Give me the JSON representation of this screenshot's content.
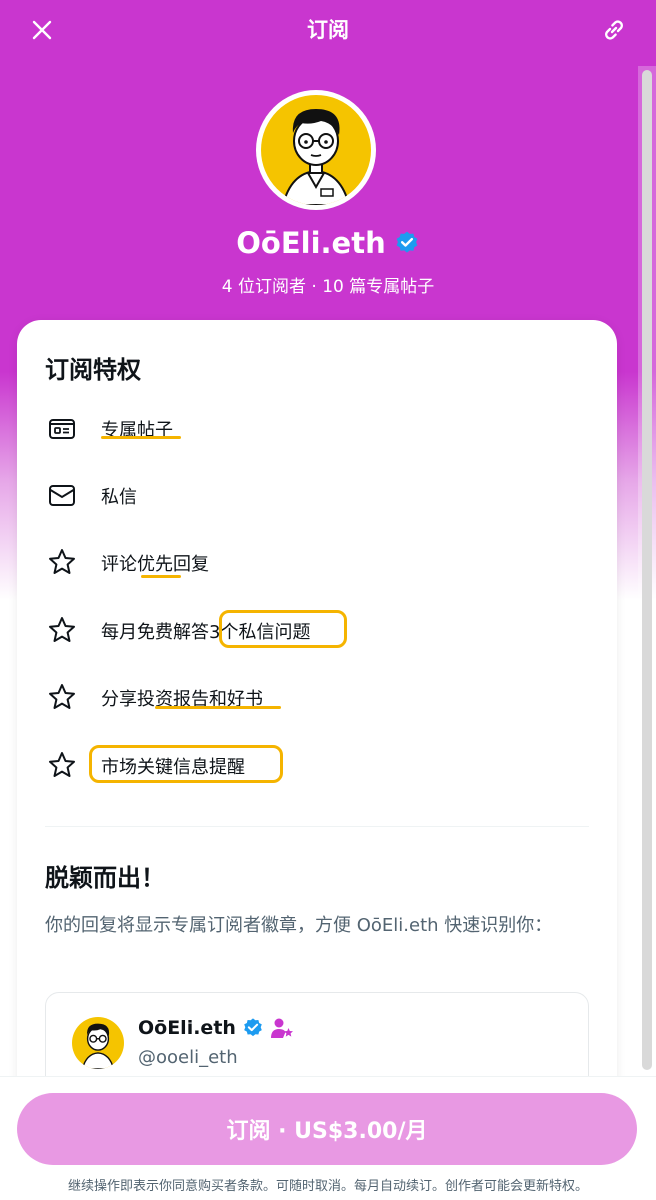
{
  "header": {
    "title": "订阅",
    "close_icon": "close-icon",
    "link_icon": "link-icon"
  },
  "profile": {
    "name": "OōEli.eth",
    "verified_icon": "verified-badge-icon",
    "stats": "4 位订阅者 · 10 篇专属帖子"
  },
  "perks": {
    "title": "订阅特权",
    "items": [
      {
        "icon": "post-card-icon",
        "label": "专属帖子"
      },
      {
        "icon": "mail-icon",
        "label": "私信"
      },
      {
        "icon": "star-icon",
        "label": "评论优先回复"
      },
      {
        "icon": "star-icon",
        "label": "每月免费解答3个私信问题"
      },
      {
        "icon": "star-icon",
        "label": "分享投资报告和好书"
      },
      {
        "icon": "star-icon",
        "label": "市场关键信息提醒"
      }
    ]
  },
  "standout": {
    "title": "脱颖而出！",
    "description": "你的回复将显示专属订阅者徽章，方便 OōEli.eth 快速识别你：",
    "preview": {
      "name": "OōEli.eth",
      "handle": "@ooeli_eth"
    }
  },
  "footer": {
    "subscribe_label": "订阅 · US$3.00/月",
    "terms": "继续操作即表示你同意购买者条款。可随时取消。每月自动续订。创作者可能会更新特权。"
  },
  "colors": {
    "brand_purple": "#c936cf",
    "button_pink": "#e899e3",
    "highlight_yellow": "#f5b400",
    "verified_blue": "#1d9bf0"
  }
}
